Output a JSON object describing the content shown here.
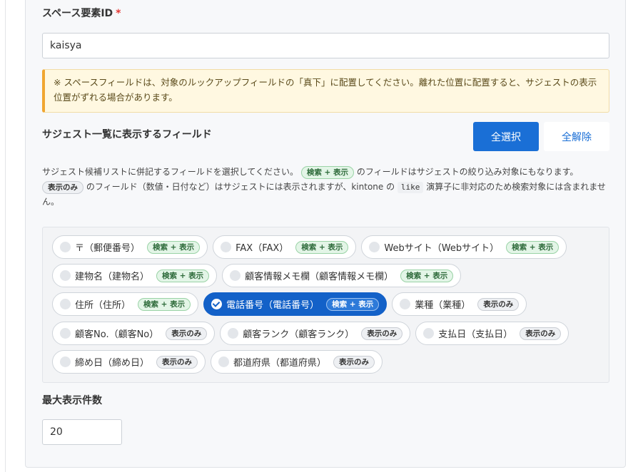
{
  "space": {
    "label": "スペース要素ID",
    "required_mark": "*",
    "value": "kaisya"
  },
  "notice": "※ スペースフィールドは、対象のルックアップフィールドの「真下」に配置してください。離れた位置に配置すると、サジェストの表示位置がずれる場合があります。",
  "suggest": {
    "label": "サジェスト一覧に表示するフィールド",
    "select_all": "全選択",
    "deselect_all": "全解除",
    "desc": {
      "p1": "サジェスト候補リストに併記するフィールドを選択してください。",
      "tag_search": "検索 + 表示",
      "p2": "のフィールドはサジェストの絞り込み対象にもなります。",
      "tag_display": "表示のみ",
      "p3": "のフィールド（数値・日付など）はサジェストには表示されますが、kintone の",
      "code": "like",
      "p4": "演算子に非対応のため検索対象には含まれません。"
    }
  },
  "fields": [
    {
      "label": "〒（郵便番号）",
      "tag": "検索 + 表示",
      "kind": "search",
      "selected": false,
      "row": 0
    },
    {
      "label": "FAX（FAX）",
      "tag": "検索 + 表示",
      "kind": "search",
      "selected": false,
      "row": 0
    },
    {
      "label": "Webサイト（Webサイト）",
      "tag": "検索 + 表示",
      "kind": "search",
      "selected": false,
      "row": 0
    },
    {
      "label": "建物名（建物名）",
      "tag": "検索 + 表示",
      "kind": "search",
      "selected": false,
      "row": 1
    },
    {
      "label": "顧客情報メモ欄（顧客情報メモ欄）",
      "tag": "検索 + 表示",
      "kind": "search",
      "selected": false,
      "row": 1
    },
    {
      "label": "住所（住所）",
      "tag": "検索 + 表示",
      "kind": "search",
      "selected": false,
      "row": 2
    },
    {
      "label": "電話番号（電話番号）",
      "tag": "検索 + 表示",
      "kind": "search",
      "selected": true,
      "row": 2
    },
    {
      "label": "業種（業種）",
      "tag": "表示のみ",
      "kind": "display",
      "selected": false,
      "row": 2
    },
    {
      "label": "顧客No.（顧客No）",
      "tag": "表示のみ",
      "kind": "display",
      "selected": false,
      "row": 3
    },
    {
      "label": "顧客ランク（顧客ランク）",
      "tag": "表示のみ",
      "kind": "display",
      "selected": false,
      "row": 3
    },
    {
      "label": "支払日（支払日）",
      "tag": "表示のみ",
      "kind": "display",
      "selected": false,
      "row": 3
    },
    {
      "label": "締め日（締め日）",
      "tag": "表示のみ",
      "kind": "display",
      "selected": false,
      "row": 4
    },
    {
      "label": "都道府県（都道府県）",
      "tag": "表示のみ",
      "kind": "display",
      "selected": false,
      "row": 4
    }
  ],
  "max": {
    "label": "最大表示件数",
    "value": "20"
  },
  "colors": {
    "primary": "#1a6fd6",
    "warning_border": "#f0a630",
    "required": "#e53935"
  }
}
